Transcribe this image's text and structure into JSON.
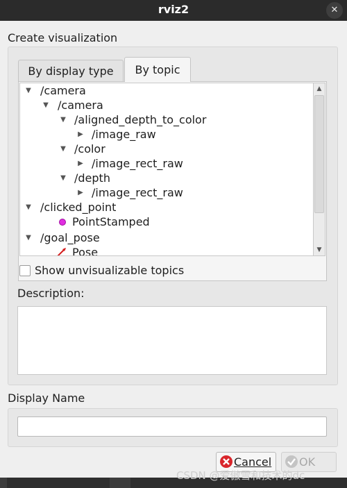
{
  "window": {
    "title": "rviz2"
  },
  "create_label": "Create visualization",
  "tabs": [
    "By display type",
    "By topic"
  ],
  "tree": [
    {
      "label": "/camera",
      "expanded": true
    },
    {
      "label": "/camera",
      "expanded": true
    },
    {
      "label": "/aligned_depth_to_color",
      "expanded": true
    },
    {
      "label": "/image_raw",
      "expanded": false
    },
    {
      "label": "/color",
      "expanded": true
    },
    {
      "label": "/image_rect_raw",
      "expanded": false
    },
    {
      "label": "/depth",
      "expanded": true
    },
    {
      "label": "/image_rect_raw",
      "expanded": false
    },
    {
      "label": "/clicked_point",
      "expanded": true
    },
    {
      "label": "PointStamped",
      "icon": "point-stamped-icon",
      "color": "#e02ee0"
    },
    {
      "label": "/goal_pose",
      "expanded": true
    },
    {
      "label": "Pose",
      "icon": "pose-arrow-icon",
      "color": "#d41c1c"
    }
  ],
  "show_unvisualizable": {
    "label": "Show unvisualizable topics",
    "checked": false
  },
  "description": {
    "label": "Description:",
    "text": ""
  },
  "display_name": {
    "label": "Display Name",
    "value": ""
  },
  "buttons": {
    "cancel": {
      "label": "Cancel",
      "icon": "cancel-icon"
    },
    "ok": {
      "label": "OK",
      "icon": "ok-check-icon",
      "enabled": false
    }
  },
  "watermark": "CSDN @爱傲雪和技术的dc"
}
